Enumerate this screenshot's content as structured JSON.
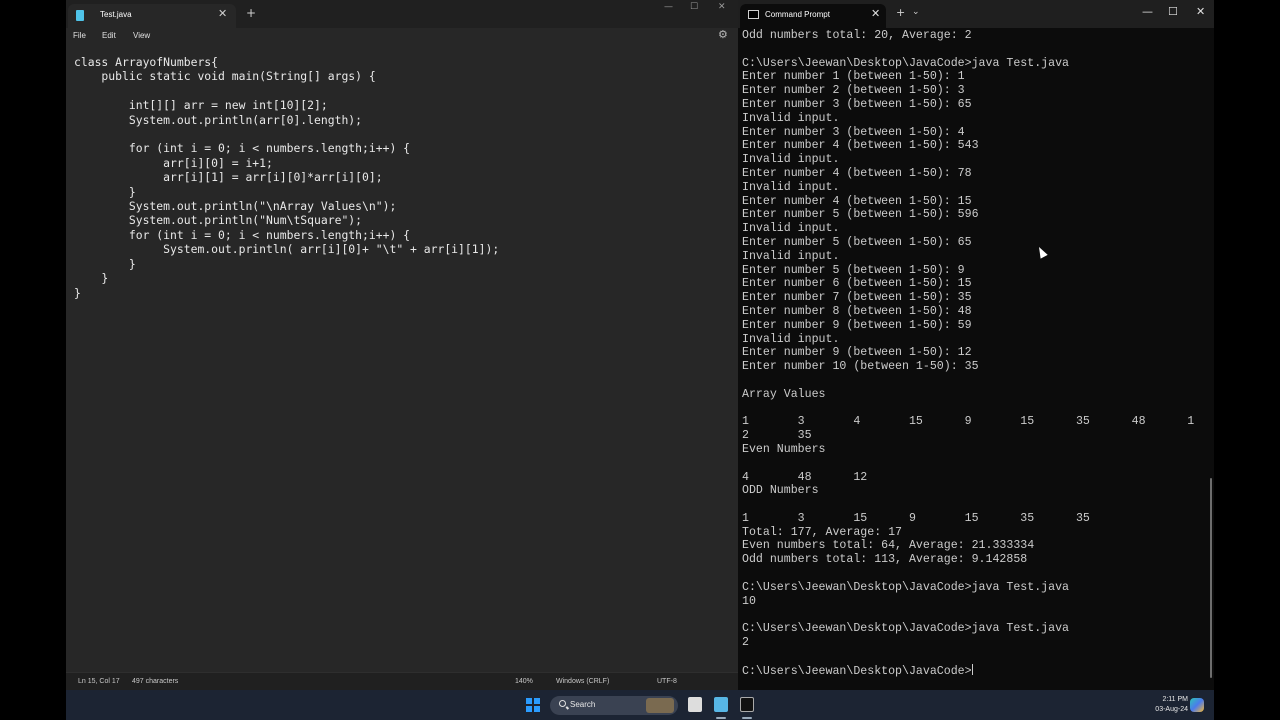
{
  "notepad": {
    "tab_title": "Test.java",
    "tab_close": "✕",
    "new_tab": "+",
    "window_controls": {
      "minimize": "—",
      "maximize": "☐",
      "close": "✕"
    },
    "menu": [
      "File",
      "Edit",
      "View"
    ],
    "settings_icon": "gear-icon",
    "code": "class ArrayofNumbers{\n    public static void main(String[] args) {\n\n        int[][] arr = new int[10][2];\n        System.out.println(arr[0].length);\n\n        for (int i = 0; i < numbers.length;i++) {\n             arr[i][0] = i+1;\n             arr[i][1] = arr[i][0]*arr[i][0];\n        }\n        System.out.println(\"\\nArray Values\\n\");\n        System.out.println(\"Num\\tSquare\");\n        for (int i = 0; i < numbers.length;i++) {\n             System.out.println( arr[i][0]+ \"\\t\" + arr[i][1]);\n        }\n    }\n}",
    "status": {
      "position": "Ln 15, Col 17",
      "characters": "497 characters",
      "zoom": "140%",
      "line_ending": "Windows (CRLF)",
      "encoding": "UTF-8"
    }
  },
  "cmd": {
    "tab_title": "Command Prompt",
    "tab_close": "✕",
    "new_tab": "+",
    "dropdown": "⌄",
    "window_controls": {
      "minimize": "—",
      "maximize": "☐",
      "close": "✕"
    },
    "output": "Odd numbers total: 20, Average: 2\n\nC:\\Users\\Jeewan\\Desktop\\JavaCode>java Test.java\nEnter number 1 (between 1-50): 1\nEnter number 2 (between 1-50): 3\nEnter number 3 (between 1-50): 65\nInvalid input.\nEnter number 3 (between 1-50): 4\nEnter number 4 (between 1-50): 543\nInvalid input.\nEnter number 4 (between 1-50): 78\nInvalid input.\nEnter number 4 (between 1-50): 15\nEnter number 5 (between 1-50): 596\nInvalid input.\nEnter number 5 (between 1-50): 65\nInvalid input.\nEnter number 5 (between 1-50): 9\nEnter number 6 (between 1-50): 15\nEnter number 7 (between 1-50): 35\nEnter number 8 (between 1-50): 48\nEnter number 9 (between 1-50): 59\nInvalid input.\nEnter number 9 (between 1-50): 12\nEnter number 10 (between 1-50): 35\n\nArray Values\n\n1       3       4       15      9       15      35      48      1\n2       35\nEven Numbers\n\n4       48      12\nODD Numbers\n\n1       3       15      9       15      35      35\nTotal: 177, Average: 17\nEven numbers total: 64, Average: 21.333334\nOdd numbers total: 113, Average: 9.142858\n\nC:\\Users\\Jeewan\\Desktop\\JavaCode>java Test.java\n10\n\nC:\\Users\\Jeewan\\Desktop\\JavaCode>java Test.java\n2\n\nC:\\Users\\Jeewan\\Desktop\\JavaCode>"
  },
  "taskbar": {
    "search_label": "Search",
    "time": "2:11 PM",
    "date": "03-Aug-24",
    "apps": [
      "windows-start-icon",
      "file-explorer-icon",
      "notepad-icon",
      "terminal-icon",
      "copilot-icon"
    ]
  }
}
